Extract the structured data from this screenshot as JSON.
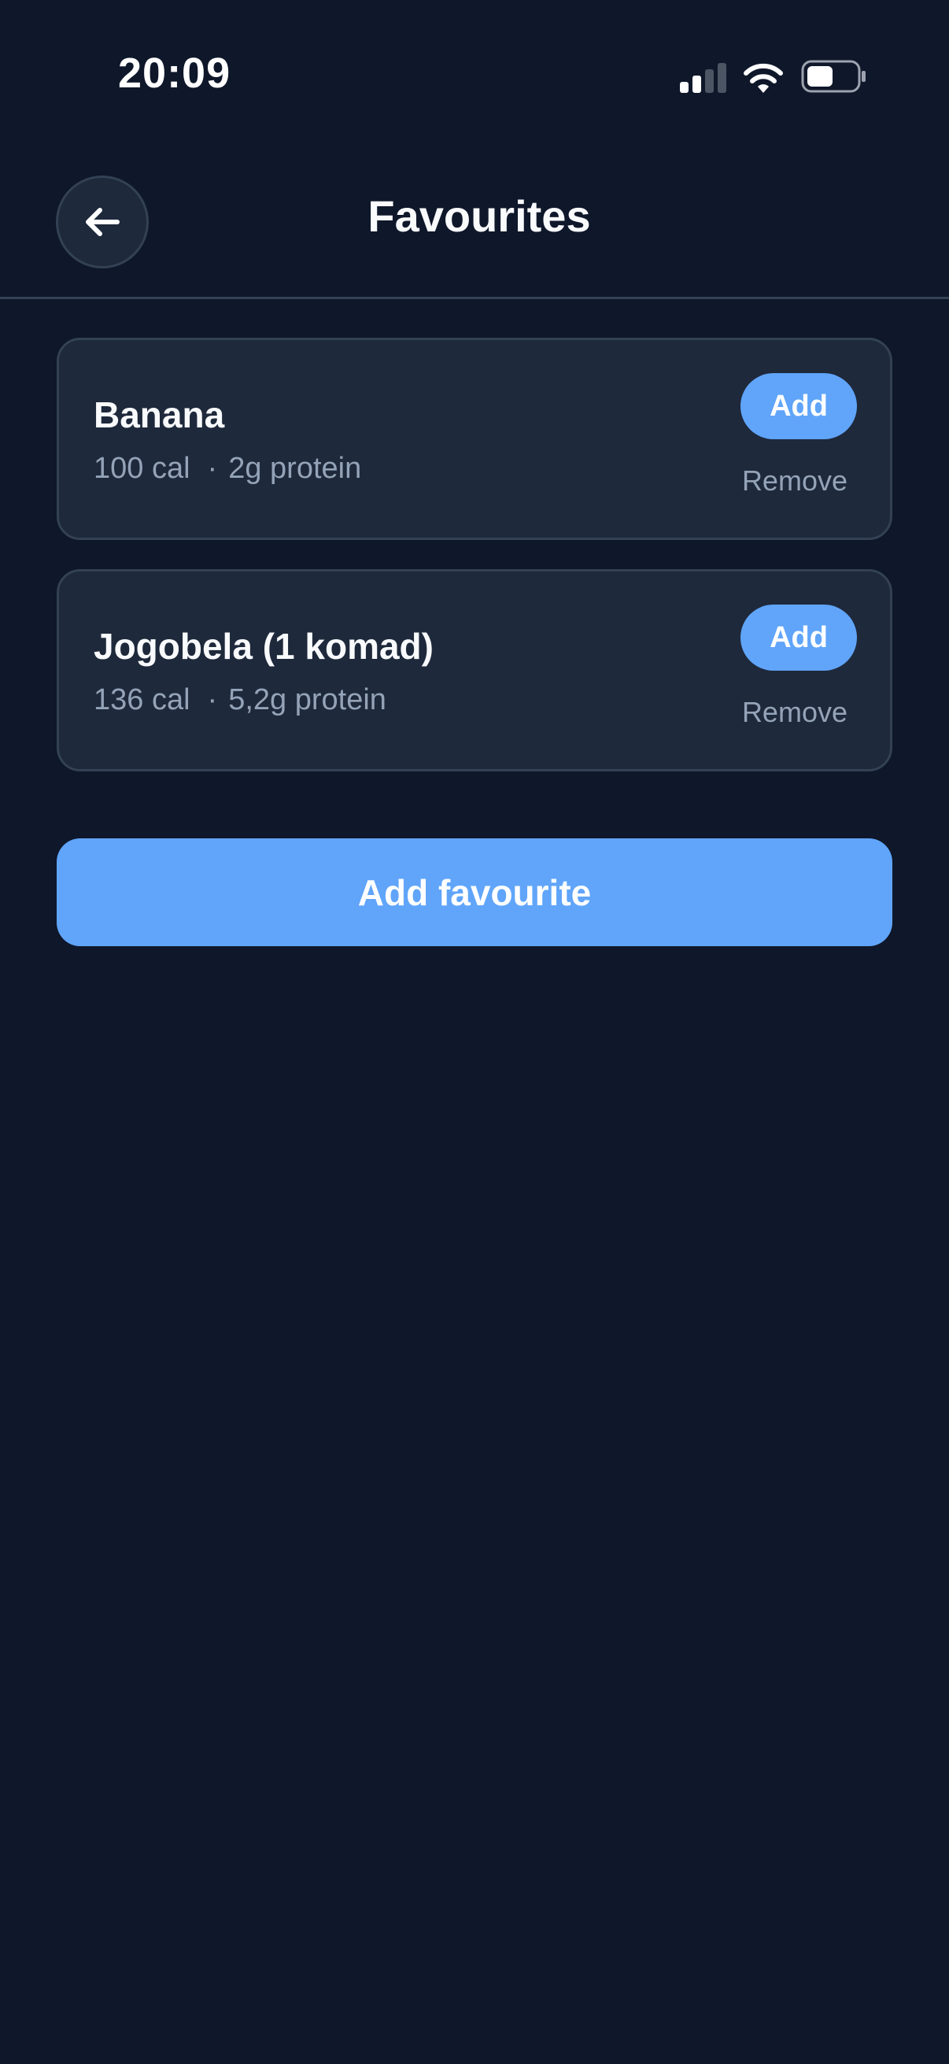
{
  "status_bar": {
    "time": "20:09",
    "icons": [
      "signal-icon",
      "wifi-icon",
      "battery-icon"
    ]
  },
  "header": {
    "title": "Favourites",
    "back_icon": "arrow-left-icon"
  },
  "favourites": [
    {
      "name": "Banana",
      "calories": "100 cal",
      "separator": "·",
      "protein": "2g protein",
      "add_label": "Add",
      "remove_label": "Remove"
    },
    {
      "name": "Jogobela (1 komad)",
      "calories": "136 cal",
      "separator": "·",
      "protein": "5,2g protein",
      "add_label": "Add",
      "remove_label": "Remove"
    }
  ],
  "actions": {
    "add_favourite_label": "Add favourite"
  },
  "colors": {
    "background": "#0f172a",
    "card": "#1e293b",
    "border": "#334155",
    "accent": "#60a5fa",
    "muted_text": "#94a3b8",
    "text": "#f8fafc"
  }
}
